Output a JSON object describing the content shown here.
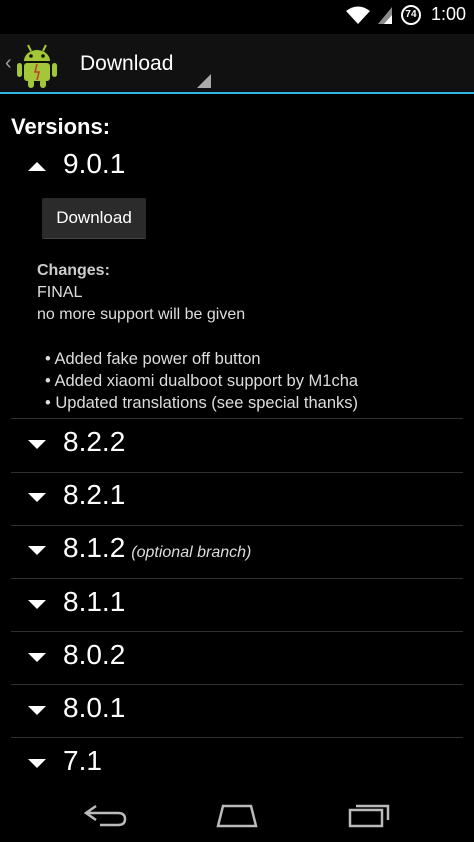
{
  "status_bar": {
    "time": "1:00",
    "battery_level": "74"
  },
  "action_bar": {
    "title": "Download"
  },
  "content": {
    "versions_label": "Versions:",
    "expanded_version": {
      "version": "9.0.1",
      "download_label": "Download",
      "changes_title": "Changes:",
      "changes_lines": [
        "FINAL",
        "no more support will be given"
      ],
      "bullets": [
        "• Added fake power off button",
        "• Added xiaomi dualboot support by M1cha",
        "• Updated translations (see special thanks)"
      ]
    },
    "versions": [
      {
        "version": "8.2.2",
        "note": ""
      },
      {
        "version": "8.2.1",
        "note": ""
      },
      {
        "version": "8.1.2",
        "note": "(optional branch)"
      },
      {
        "version": "8.1.1",
        "note": ""
      },
      {
        "version": "8.0.2",
        "note": ""
      },
      {
        "version": "8.0.1",
        "note": ""
      },
      {
        "version": "7.1",
        "note": ""
      }
    ]
  },
  "colors": {
    "accent": "#33b5e5",
    "android_green": "#a4c639",
    "background": "#000000"
  },
  "icons": {
    "status": [
      "wifi-icon",
      "signal-icon",
      "battery-icon"
    ],
    "nav": [
      "back-icon",
      "home-icon",
      "recents-icon"
    ]
  }
}
